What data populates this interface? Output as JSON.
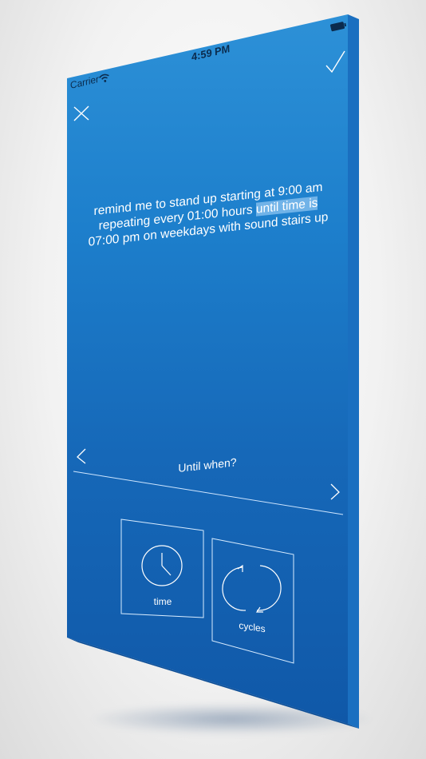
{
  "status_bar": {
    "carrier": "Carrier",
    "time": "4:59 PM"
  },
  "toolbar": {
    "close_icon": "close-icon",
    "confirm_icon": "checkmark-icon"
  },
  "sentence": {
    "plain": "remind me to stand up starting at 9:00 am repeating every 01:00 hours ",
    "highlighted": "until time is",
    "rest": " 07:00 pm on weekdays with sound stairs up"
  },
  "question": {
    "text": "Until when?"
  },
  "options": [
    {
      "label": "time",
      "icon": "clock-icon"
    },
    {
      "label": "cycles",
      "icon": "cycle-icon"
    }
  ],
  "colors": {
    "screen_top": "#2e92d8",
    "screen_bottom": "#0f56a6",
    "highlight": "#b4dcff"
  }
}
